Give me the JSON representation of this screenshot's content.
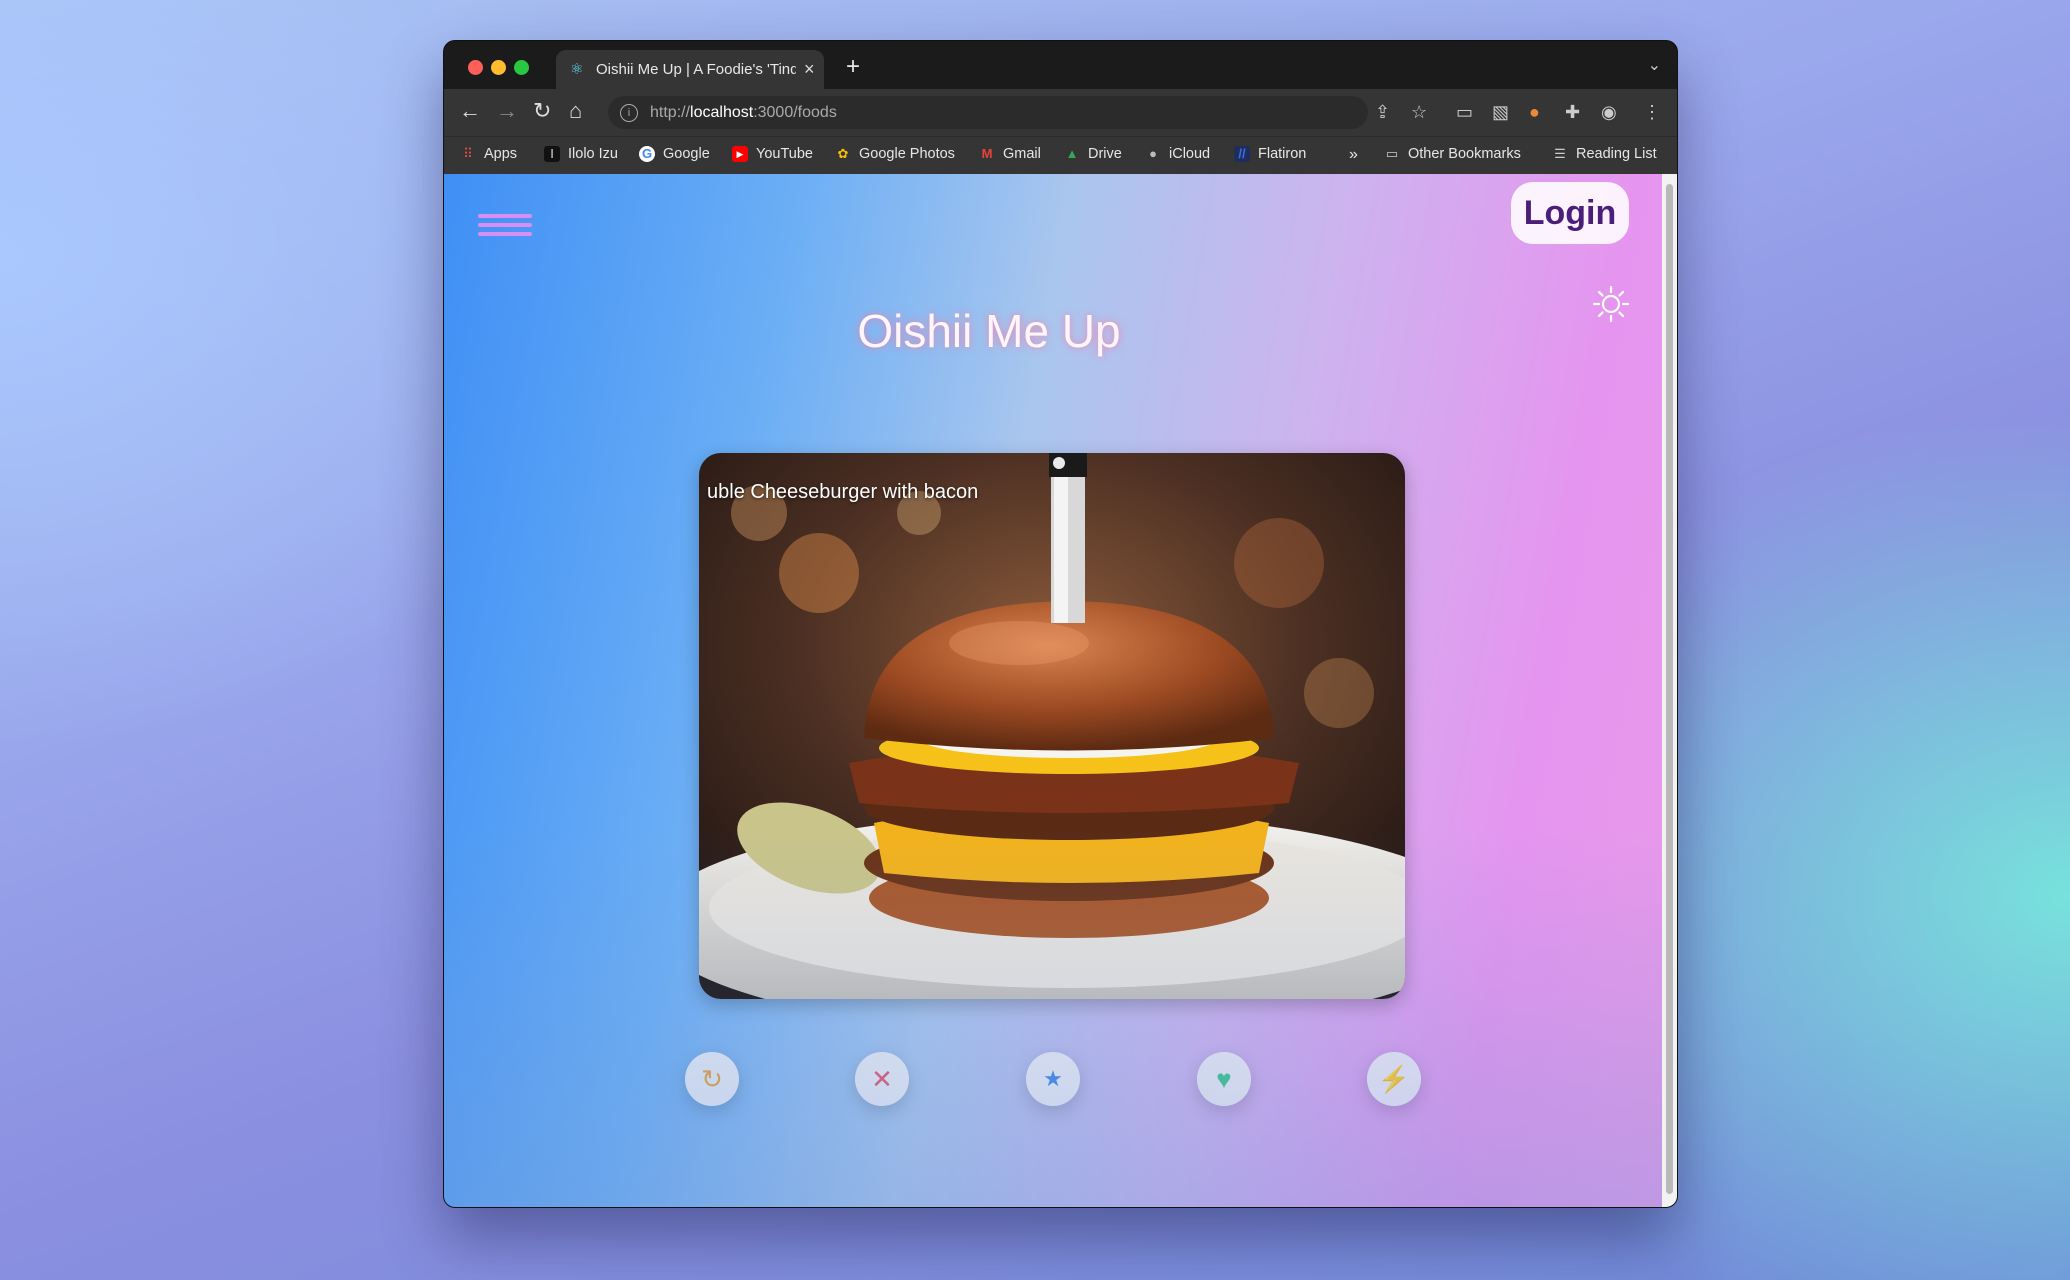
{
  "browser": {
    "tab_title": "Oishii Me Up | A Foodie's 'Tinder'",
    "tab_close": "×",
    "new_tab": "+",
    "url_prefix": "http://",
    "url_host": "localhost",
    "url_rest": ":3000/foods",
    "bookmarks": [
      {
        "label": "Apps",
        "icon": "apps-grid-icon",
        "color": "#e0543e"
      },
      {
        "label": "Ilolo Izu",
        "icon": "ilolo-icon",
        "color": "#dddddd"
      },
      {
        "label": "Google",
        "icon": "google-icon",
        "color": "#4285f4"
      },
      {
        "label": "YouTube",
        "icon": "youtube-icon",
        "color": "#ff0000"
      },
      {
        "label": "Google Photos",
        "icon": "google-photos-icon",
        "color": "#fbbc04"
      },
      {
        "label": "Gmail",
        "icon": "gmail-icon",
        "color": "#ea4335"
      },
      {
        "label": "Drive",
        "icon": "drive-icon",
        "color": "#34a853"
      },
      {
        "label": "iCloud",
        "icon": "apple-icon",
        "color": "#bbbbbb"
      },
      {
        "label": "Flatiron",
        "icon": "flatiron-icon",
        "color": "#3b6ee8"
      }
    ],
    "bookmarks_overflow": "»",
    "other_bookmarks": "Other Bookmarks",
    "reading_list": "Reading List"
  },
  "app": {
    "title": "Oishii Me Up",
    "login_label": "Login",
    "card": {
      "food_name": "uble Cheeseburger with bacon"
    },
    "actions": [
      {
        "name": "undo-button",
        "icon": "undo-icon",
        "glyph": "↻",
        "color": "#e6a23c"
      },
      {
        "name": "dislike-button",
        "icon": "x-icon",
        "glyph": "✕",
        "color": "#e4566c"
      },
      {
        "name": "star-button",
        "icon": "star-icon",
        "glyph": "★",
        "color": "#3f86e6"
      },
      {
        "name": "like-button",
        "icon": "heart-icon",
        "glyph": "♥",
        "color": "#3cc48a"
      },
      {
        "name": "boost-button",
        "icon": "lightning-icon",
        "glyph": "⚡",
        "color": "#7b3fd6"
      }
    ],
    "colors": {
      "accent_purple": "#4b1f79",
      "hamburger": "#d88ef2"
    }
  }
}
